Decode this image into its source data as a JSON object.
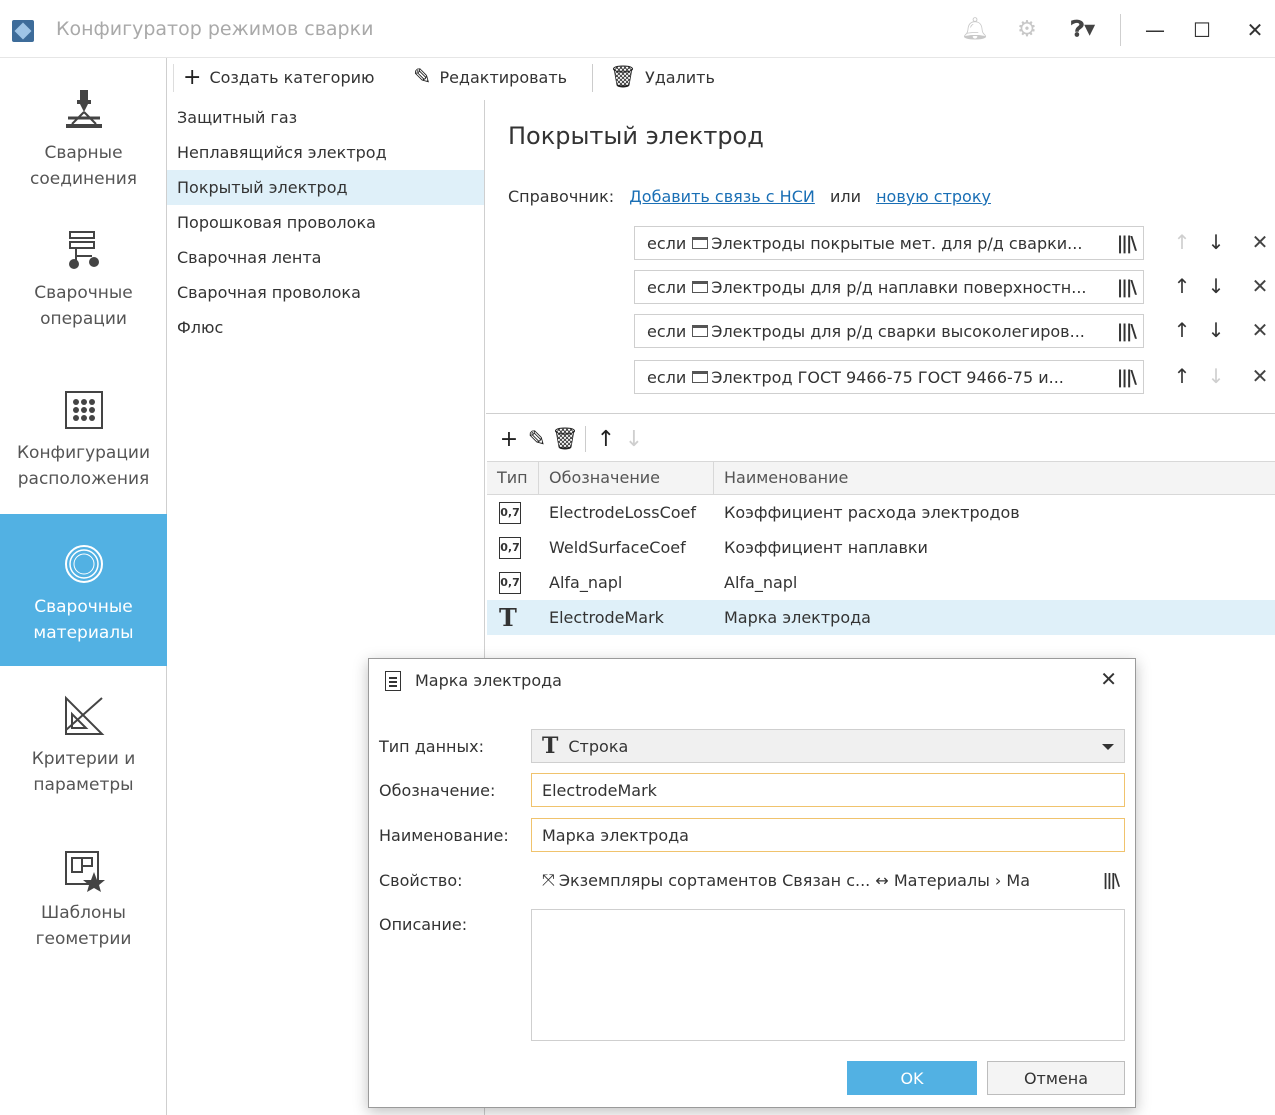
{
  "app": {
    "title": "Конфигуратор режимов сварки"
  },
  "nav": {
    "items": [
      {
        "label1": "Сварные",
        "label2": "соединения"
      },
      {
        "label1": "Сварочные",
        "label2": "операции"
      },
      {
        "label1": "Конфигурации",
        "label2": "расположения"
      },
      {
        "label1": "Сварочные",
        "label2": "материалы"
      },
      {
        "label1": "Критерии и",
        "label2": "параметры"
      },
      {
        "label1": "Шаблоны",
        "label2": "геометрии"
      }
    ]
  },
  "toolbar": {
    "create": "Создать категорию",
    "edit": "Редактировать",
    "delete": "Удалить"
  },
  "categories": [
    "Защитный газ",
    "Неплавящийся электрод",
    "Покрытый электрод",
    "Порошковая проволока",
    "Сварочная лента",
    "Сварочная проволока",
    "Флюс"
  ],
  "detail": {
    "title": "Покрытый электрод",
    "ref_label": "Справочник:",
    "ref_link1": "Добавить связь с НСИ",
    "ref_or": "или",
    "ref_link2": "новую строку",
    "conditions": [
      {
        "prefix": "если",
        "text": "Электроды покрытые мет. для р/д сварки..."
      },
      {
        "prefix": "если",
        "text": "Электроды для р/д наплавки поверхностн..."
      },
      {
        "prefix": "если",
        "text": "Электроды для р/д сварки высоколегиров..."
      },
      {
        "prefix": "если",
        "text": "Электрод ГОСТ 9466-75 ГОСТ 9466-75 и..."
      }
    ]
  },
  "grid": {
    "headers": [
      "Тип",
      "Обозначение",
      "Наименование"
    ],
    "rows": [
      {
        "type": "0,7",
        "code": "ElectrodeLossCoef",
        "name": "Коэффициент расхода электродов"
      },
      {
        "type": "0,7",
        "code": "WeldSurfaceCoef",
        "name": "Коэффициент наплавки"
      },
      {
        "type": "0,7",
        "code": "Alfa_napl",
        "name": "Alfa_napl"
      },
      {
        "type": "T",
        "code": "ElectrodeMark",
        "name": "Марка электрода"
      }
    ]
  },
  "dialog": {
    "title": "Марка электрода",
    "datatype_label": "Тип данных:",
    "datatype_value": "Строка",
    "code_label": "Обозначение:",
    "code_value": "ElectrodeMark",
    "name_label": "Наименование:",
    "name_value": "Марка электрода",
    "property_label": "Свойство:",
    "property_value": "Экземпляры сортаментов Связан с... ↔ Материалы › Ма",
    "desc_label": "Описание:",
    "ok": "OK",
    "cancel": "Отмена"
  },
  "colors": {
    "accent": "#52b1e3",
    "selection": "#dff0f9",
    "link": "#1a6fb5"
  }
}
